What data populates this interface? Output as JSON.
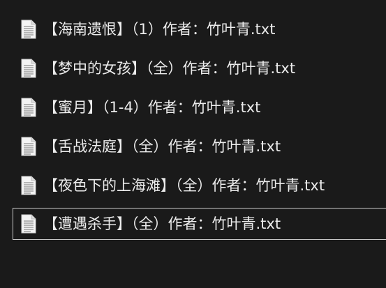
{
  "files": [
    {
      "name": "【海南遗恨】（1）作者：竹叶青.txt",
      "icon": "text-file-icon",
      "selected": false
    },
    {
      "name": "【梦中的女孩】（全）作者：竹叶青.txt",
      "icon": "text-file-icon",
      "selected": false
    },
    {
      "name": "【蜜月】（1-4）作者：竹叶青.txt",
      "icon": "text-file-icon",
      "selected": false
    },
    {
      "name": "【舌战法庭】（全）作者：竹叶青.txt",
      "icon": "text-file-icon",
      "selected": false
    },
    {
      "name": "【夜色下的上海滩】（全）作者：竹叶青.txt",
      "icon": "text-file-icon",
      "selected": false
    },
    {
      "name": "【遭遇杀手】（全）作者：竹叶青.txt",
      "icon": "text-file-icon",
      "selected": true
    }
  ]
}
